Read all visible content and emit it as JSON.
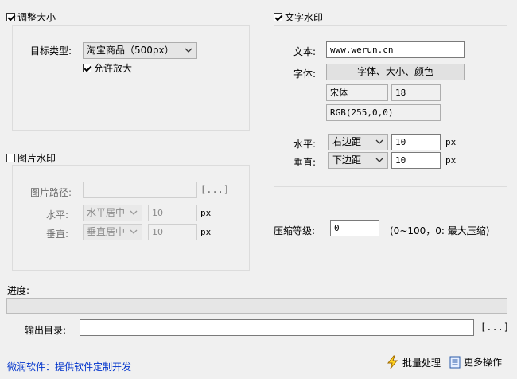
{
  "resize": {
    "title": "调整大小",
    "checked": true,
    "target_label": "目标类型:",
    "target_value": "淘宝商品（500px）",
    "allow_enlarge_label": "允许放大",
    "allow_enlarge_checked": true
  },
  "text_watermark": {
    "title": "文字水印",
    "checked": true,
    "text_label": "文本:",
    "text_value": "www.werun.cn",
    "font_label": "字体:",
    "font_button": "字体、大小、颜色",
    "font_name": "宋体",
    "font_size": "18",
    "font_color": "RGB(255,0,0)",
    "horizontal_label": "水平:",
    "horizontal_value": "右边距",
    "horizontal_offset": "10",
    "vertical_label": "垂直:",
    "vertical_value": "下边距",
    "vertical_offset": "10",
    "unit": "px"
  },
  "image_watermark": {
    "title": "图片水印",
    "checked": false,
    "path_label": "图片路径:",
    "path_value": "",
    "browse_label": "[...]",
    "horizontal_label": "水平:",
    "horizontal_value": "水平居中",
    "horizontal_offset": "10",
    "vertical_label": "垂直:",
    "vertical_value": "垂直居中",
    "vertical_offset": "10",
    "unit": "px"
  },
  "compression": {
    "label": "压缩等级:",
    "value": "0",
    "hint": "(0~100，0: 最大压缩)"
  },
  "progress": {
    "label": "进度:",
    "percent": 0
  },
  "output": {
    "label": "输出目录:",
    "value": "",
    "browse_label": "[...]"
  },
  "footer": {
    "link": "微润软件：提供软件定制开发",
    "batch_label": "批量处理",
    "more_label": "更多操作"
  }
}
